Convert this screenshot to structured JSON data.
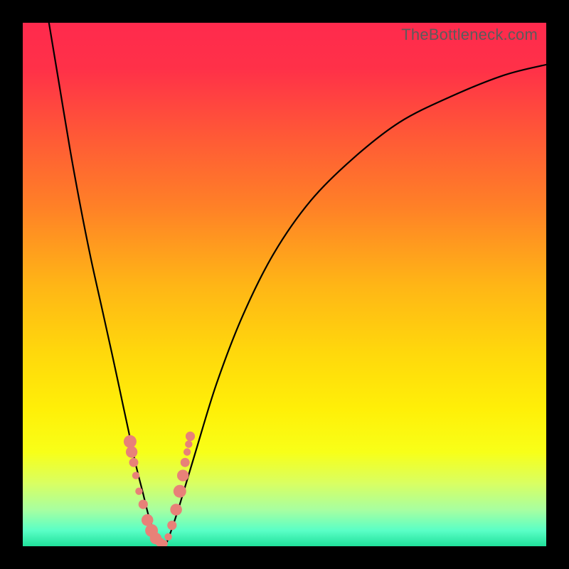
{
  "watermark": "TheBottleneck.com",
  "colors": {
    "gradient_stops": [
      {
        "offset": 0.0,
        "color": "#ff2a4d"
      },
      {
        "offset": 0.09,
        "color": "#ff3148"
      },
      {
        "offset": 0.22,
        "color": "#ff5a36"
      },
      {
        "offset": 0.35,
        "color": "#ff8027"
      },
      {
        "offset": 0.5,
        "color": "#ffb516"
      },
      {
        "offset": 0.63,
        "color": "#ffd80c"
      },
      {
        "offset": 0.74,
        "color": "#fff008"
      },
      {
        "offset": 0.82,
        "color": "#f8ff18"
      },
      {
        "offset": 0.88,
        "color": "#d9ff62"
      },
      {
        "offset": 0.93,
        "color": "#a8ffa0"
      },
      {
        "offset": 0.97,
        "color": "#5affc6"
      },
      {
        "offset": 1.0,
        "color": "#20e19b"
      }
    ],
    "dot_color": "#e88178",
    "curve_color": "#000000",
    "frame_color": "#000000"
  },
  "chart_data": {
    "type": "line",
    "title": "",
    "xlabel": "",
    "ylabel": "",
    "xlim": [
      0,
      100
    ],
    "ylim": [
      0,
      100
    ],
    "grid": false,
    "legend": false,
    "series": [
      {
        "name": "bottleneck-v-curve",
        "x": [
          5,
          7,
          9,
          11,
          13,
          15,
          17,
          18.5,
          20,
          21.5,
          23,
          24,
          25,
          26,
          27,
          28,
          30,
          33,
          37,
          42,
          48,
          55,
          63,
          72,
          82,
          92,
          100
        ],
        "y": [
          100,
          88,
          76,
          65,
          55,
          46,
          37,
          30,
          23,
          16,
          10,
          6,
          3,
          1,
          0,
          2,
          8,
          18,
          31,
          44,
          56,
          66,
          74,
          81,
          86,
          90,
          92
        ]
      },
      {
        "name": "highlight-markers",
        "x": [
          20.5,
          20.8,
          21.2,
          21.6,
          22.2,
          23.0,
          23.8,
          24.6,
          25.4,
          26.2,
          27.0,
          27.8,
          28.5,
          29.3,
          30.0,
          30.6,
          31.0,
          31.4,
          31.7,
          32.0
        ],
        "y": [
          20.0,
          18.0,
          16.0,
          13.5,
          10.5,
          8.0,
          5.0,
          3.0,
          1.5,
          0.8,
          0.5,
          1.8,
          4.0,
          7.0,
          10.5,
          13.5,
          16.0,
          18.0,
          19.5,
          21.0
        ]
      }
    ],
    "annotations": [
      {
        "text": "TheBottleneck.com",
        "position": "top-right"
      }
    ]
  }
}
